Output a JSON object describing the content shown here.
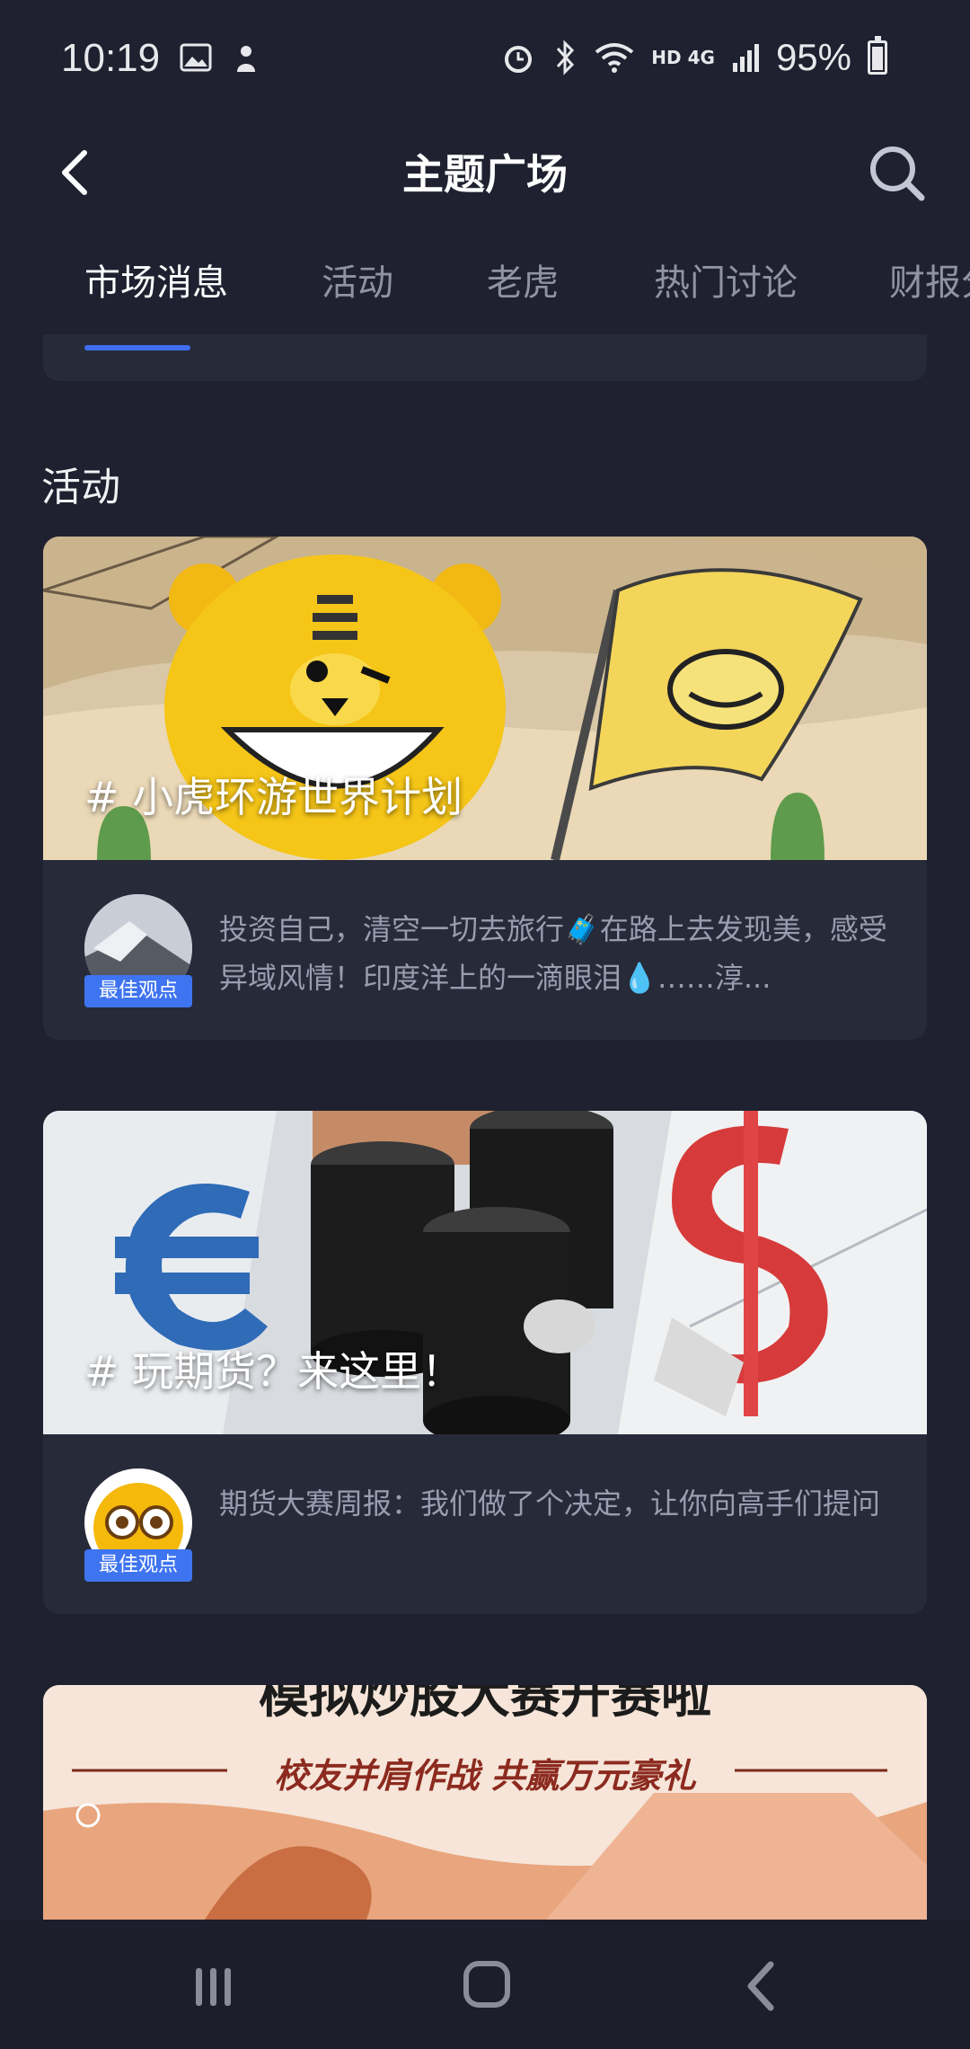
{
  "status_bar": {
    "time": "10:19",
    "battery": "95%",
    "network": "HD 4G"
  },
  "header": {
    "title": "主题广场"
  },
  "tabs": [
    {
      "label": "市场消息",
      "active": true
    },
    {
      "label": "活动",
      "active": false
    },
    {
      "label": "老虎",
      "active": false
    },
    {
      "label": "热门讨论",
      "active": false
    },
    {
      "label": "财报分",
      "active": false
    }
  ],
  "section": {
    "title": "活动"
  },
  "cards": [
    {
      "topic": "# 小虎环游世界计划",
      "badge": "最佳观点",
      "excerpt": "投资自己，清空一切去旅行🧳在路上去发现美，感受异域风情！印度洋上的一滴眼泪💧……淳..."
    },
    {
      "topic": "# 玩期货？来这里！",
      "badge": "最佳观点",
      "excerpt": "期货大赛周报：我们做了个决定，让你向高手们提问"
    },
    {
      "banner_title": "模拟炒股大赛开赛啦",
      "banner_subtitle": "校友并肩作战  共赢万元豪礼"
    }
  ],
  "colors": {
    "background": "#1f2130",
    "card": "#272a39",
    "accent": "#3f74f0"
  }
}
